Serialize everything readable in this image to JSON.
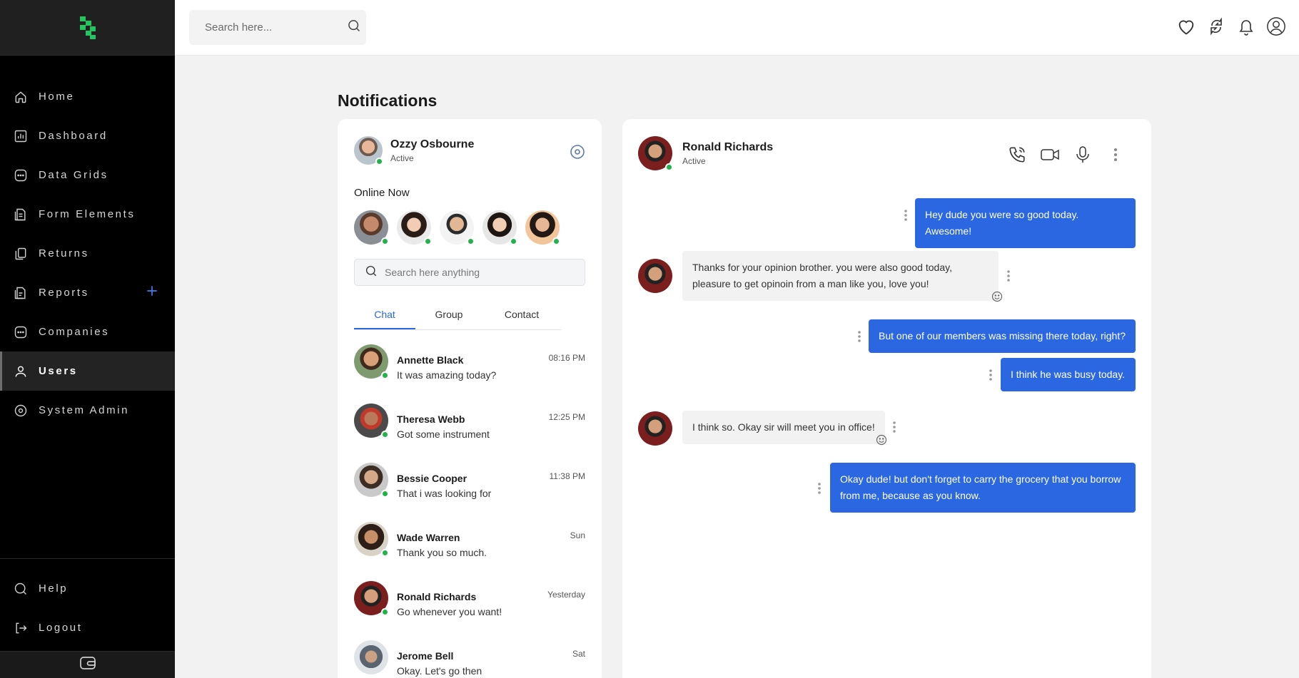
{
  "sidebar": {
    "items": [
      {
        "label": "Home",
        "icon": "home-icon"
      },
      {
        "label": "Dashboard",
        "icon": "bar-chart-icon"
      },
      {
        "label": "Data Grids",
        "icon": "grid-dots-icon"
      },
      {
        "label": "Form Elements",
        "icon": "form-icon"
      },
      {
        "label": "Returns",
        "icon": "documents-icon"
      },
      {
        "label": "Reports",
        "icon": "report-icon"
      },
      {
        "label": "Companies",
        "icon": "companies-icon"
      },
      {
        "label": "Users",
        "icon": "user-icon",
        "active": true
      },
      {
        "label": "System Admin",
        "icon": "gear-icon"
      }
    ],
    "bottom": [
      {
        "label": "Help",
        "icon": "help-icon"
      },
      {
        "label": "Logout",
        "icon": "logout-icon"
      }
    ]
  },
  "topbar": {
    "search_placeholder": "Search here..."
  },
  "page": {
    "title": "Notifications"
  },
  "profile": {
    "name": "Ozzy Osbourne",
    "status": "Active"
  },
  "online": {
    "label": "Online Now"
  },
  "chat_search": {
    "placeholder": "Search here anything"
  },
  "tabs": [
    "Chat",
    "Group",
    "Contact"
  ],
  "chats": [
    {
      "name": "Annette Black",
      "message": "It was amazing today?",
      "time": "08:16 PM"
    },
    {
      "name": "Theresa Webb",
      "message": "Got some instrument",
      "time": "12:25 PM"
    },
    {
      "name": "Bessie Cooper",
      "message": "That i was looking for",
      "time": "11:38 PM"
    },
    {
      "name": "Wade Warren",
      "message": "Thank you so much.",
      "time": "Sun"
    },
    {
      "name": "Ronald Richards",
      "message": "Go whenever you want!",
      "time": "Yesterday"
    },
    {
      "name": "Jerome Bell",
      "message": "Okay. Let's go then",
      "time": "Sat"
    }
  ],
  "conversation": {
    "name": "Ronald Richards",
    "status": "Active",
    "messages": [
      {
        "dir": "out",
        "text": "Hey dude you were so good today. Awesome!"
      },
      {
        "dir": "in",
        "text": "Thanks for your opinion brother. you were also good today, pleasure to get opinoin from a man like you, love you!"
      },
      {
        "dir": "out",
        "text": "But one of our members was missing there today, right?"
      },
      {
        "dir": "out",
        "text": "I think he was busy today."
      },
      {
        "dir": "in",
        "text": "I think so. Okay sir will meet you in office!"
      },
      {
        "dir": "out",
        "text": "Okay dude! but don't forget to carry the grocery that you borrow from me, because as you know."
      }
    ]
  },
  "colors": {
    "accent": "#2a67e0",
    "online": "#22b14c",
    "logo": "#22c55e"
  }
}
